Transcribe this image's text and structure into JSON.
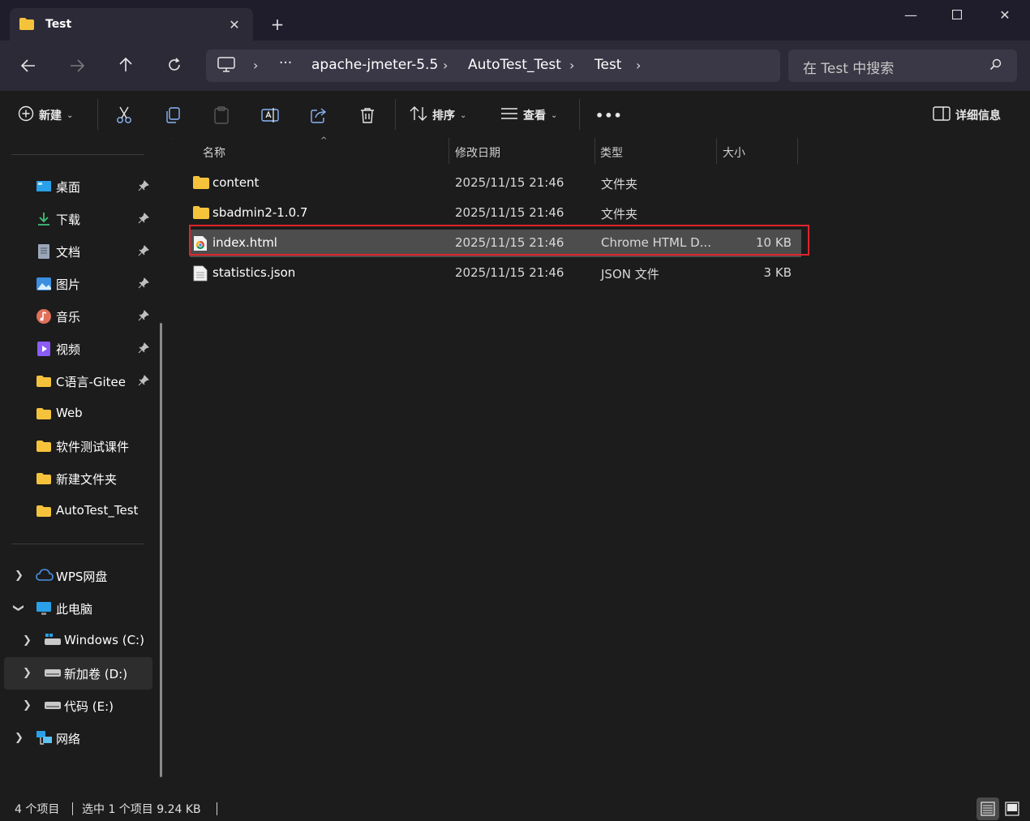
{
  "tab": {
    "title": "Test"
  },
  "address": {
    "crumbs": [
      "apache-jmeter-5.5",
      "AutoTest_Test",
      "Test"
    ],
    "more": "···"
  },
  "search": {
    "placeholder": "在 Test 中搜索"
  },
  "toolbar": {
    "new_label": "新建",
    "sort_label": "排序",
    "view_label": "查看",
    "details_label": "详细信息",
    "more": "•••"
  },
  "sidebar": {
    "quick_access": [
      {
        "label": "桌面",
        "icon": "desktop-icon",
        "pinned": true
      },
      {
        "label": "下载",
        "icon": "download-icon",
        "pinned": true
      },
      {
        "label": "文档",
        "icon": "document-icon",
        "pinned": true
      },
      {
        "label": "图片",
        "icon": "pictures-icon",
        "pinned": true
      },
      {
        "label": "音乐",
        "icon": "music-icon",
        "pinned": true
      },
      {
        "label": "视频",
        "icon": "video-icon",
        "pinned": true
      },
      {
        "label": "C语言-Gitee",
        "icon": "folder-icon",
        "pinned": true
      },
      {
        "label": "Web",
        "icon": "folder-icon",
        "pinned": false
      },
      {
        "label": "软件测试课件",
        "icon": "folder-icon",
        "pinned": false
      },
      {
        "label": "新建文件夹",
        "icon": "folder-icon",
        "pinned": false
      },
      {
        "label": "AutoTest_Test",
        "icon": "folder-icon",
        "pinned": false
      }
    ],
    "tree": {
      "wps": "WPS网盘",
      "this_pc": "此电脑",
      "drive_c": "Windows (C:)",
      "drive_d": "新加卷 (D:)",
      "drive_e": "代码 (E:)",
      "network": "网络"
    }
  },
  "columns": {
    "name": "名称",
    "date": "修改日期",
    "type": "类型",
    "size": "大小"
  },
  "files": [
    {
      "name": "content",
      "date": "2025/11/15 21:46",
      "type": "文件夹",
      "size": "",
      "icon": "folder-icon"
    },
    {
      "name": "sbadmin2-1.0.7",
      "date": "2025/11/15 21:46",
      "type": "文件夹",
      "size": "",
      "icon": "folder-icon"
    },
    {
      "name": "index.html",
      "date": "2025/11/15 21:46",
      "type": "Chrome HTML D...",
      "size": "10 KB",
      "icon": "chrome-html-icon",
      "selected": true
    },
    {
      "name": "statistics.json",
      "date": "2025/11/15 21:46",
      "type": "JSON 文件",
      "size": "3 KB",
      "icon": "file-icon"
    }
  ],
  "status": {
    "count": "4 个项目",
    "selected": "选中 1 个项目  9.24 KB"
  },
  "colors": {
    "folder": "#f5c33b",
    "selection_outline": "#e0242c",
    "background": "#1c1c1c"
  }
}
